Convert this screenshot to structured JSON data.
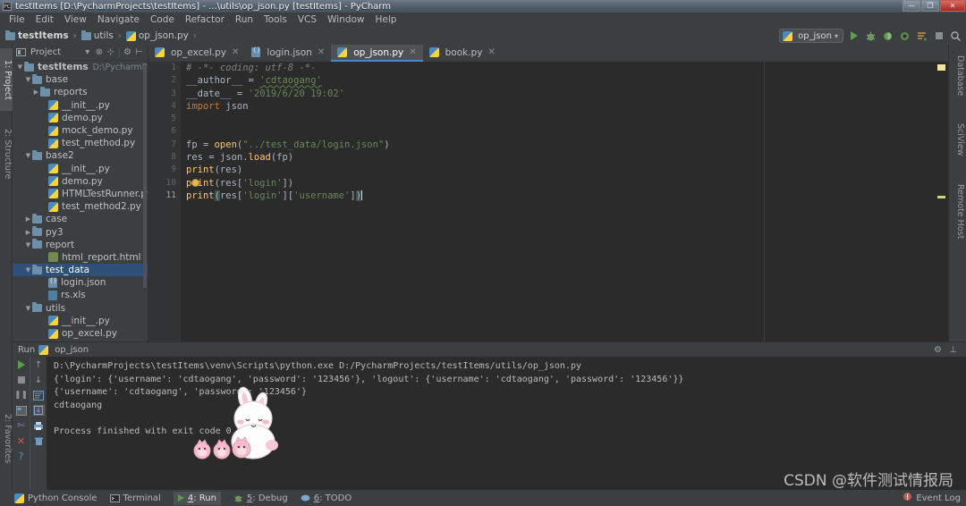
{
  "window": {
    "title": "testItems [D:\\PycharmProjects\\testItems] - ...\\utils\\op_json.py [testItems] - PyCharm",
    "app_icon": "pycharm-icon",
    "minimize_label": "—",
    "maximize_label": "❐",
    "close_label": "✕"
  },
  "menu": {
    "items": [
      "File",
      "Edit",
      "View",
      "Navigate",
      "Code",
      "Refactor",
      "Run",
      "Tools",
      "VCS",
      "Window",
      "Help"
    ]
  },
  "breadcrumb": {
    "items": [
      {
        "label": "testItems",
        "icon": "folder-icon",
        "bold": true
      },
      {
        "label": "utils",
        "icon": "folder-icon",
        "bold": false
      },
      {
        "label": "op_json.py",
        "icon": "python-file-icon",
        "bold": false
      }
    ],
    "separator": "›"
  },
  "toolbar": {
    "run_config": "op_json",
    "run_config_icon": "python-file-icon",
    "dropdown_caret": "▾",
    "buttons": [
      {
        "name": "run-button",
        "glyph": "▶"
      },
      {
        "name": "debug-button",
        "glyph": "🐞"
      },
      {
        "name": "coverage-button",
        "glyph": "◑"
      },
      {
        "name": "profile-button",
        "glyph": "◍"
      },
      {
        "name": "attach-button",
        "glyph": "≡"
      },
      {
        "name": "stop-button",
        "glyph": "■"
      },
      {
        "name": "search-button",
        "glyph": "⌕"
      }
    ]
  },
  "left_strip": {
    "tabs": [
      {
        "label": "1: Project",
        "active": true
      },
      {
        "label": "2: Structure",
        "active": false
      }
    ],
    "bottom_tabs": [
      {
        "label": "2: Favorites",
        "active": false
      }
    ]
  },
  "right_strip": {
    "tabs": [
      "Database",
      "SciView",
      "Remote Host"
    ]
  },
  "project_panel": {
    "title": "Project",
    "header_icons": [
      "project-view-icon",
      "dropdown-caret-icon",
      "collapse-all-icon",
      "scroll-from-source-icon",
      "settings-icon",
      "hide-icon"
    ],
    "tree": [
      {
        "depth": 0,
        "arrow": "▼",
        "icon": "folder-icon",
        "label": "testItems",
        "path": "D:\\PycharmProjects\\",
        "bold": true,
        "selected": false
      },
      {
        "depth": 1,
        "arrow": "▼",
        "icon": "folder-icon",
        "label": "base",
        "path": "",
        "bold": false,
        "selected": false
      },
      {
        "depth": 2,
        "arrow": "▶",
        "icon": "folder-icon",
        "label": "reports",
        "path": "",
        "bold": false,
        "selected": false
      },
      {
        "depth": 3,
        "arrow": "",
        "icon": "python-file-icon",
        "label": "__init__.py",
        "path": "",
        "bold": false,
        "selected": false
      },
      {
        "depth": 3,
        "arrow": "",
        "icon": "python-file-icon",
        "label": "demo.py",
        "path": "",
        "bold": false,
        "selected": false
      },
      {
        "depth": 3,
        "arrow": "",
        "icon": "python-file-icon",
        "label": "mock_demo.py",
        "path": "",
        "bold": false,
        "selected": false
      },
      {
        "depth": 3,
        "arrow": "",
        "icon": "python-file-icon",
        "label": "test_method.py",
        "path": "",
        "bold": false,
        "selected": false
      },
      {
        "depth": 1,
        "arrow": "▼",
        "icon": "folder-icon",
        "label": "base2",
        "path": "",
        "bold": false,
        "selected": false
      },
      {
        "depth": 3,
        "arrow": "",
        "icon": "python-file-icon",
        "label": "__init__.py",
        "path": "",
        "bold": false,
        "selected": false
      },
      {
        "depth": 3,
        "arrow": "",
        "icon": "python-file-icon",
        "label": "demo.py",
        "path": "",
        "bold": false,
        "selected": false
      },
      {
        "depth": 3,
        "arrow": "",
        "icon": "python-file-icon",
        "label": "HTMLTestRunner.py",
        "path": "",
        "bold": false,
        "selected": false
      },
      {
        "depth": 3,
        "arrow": "",
        "icon": "python-file-icon",
        "label": "test_method2.py",
        "path": "",
        "bold": false,
        "selected": false
      },
      {
        "depth": 1,
        "arrow": "▶",
        "icon": "folder-icon",
        "label": "case",
        "path": "",
        "bold": false,
        "selected": false
      },
      {
        "depth": 1,
        "arrow": "▶",
        "icon": "folder-icon",
        "label": "py3",
        "path": "",
        "bold": false,
        "selected": false
      },
      {
        "depth": 1,
        "arrow": "▼",
        "icon": "folder-icon",
        "label": "report",
        "path": "",
        "bold": false,
        "selected": false
      },
      {
        "depth": 3,
        "arrow": "",
        "icon": "html-file-icon",
        "label": "html_report.html",
        "path": "",
        "bold": false,
        "selected": false
      },
      {
        "depth": 1,
        "arrow": "▼",
        "icon": "folder-icon",
        "label": "test_data",
        "path": "",
        "bold": false,
        "selected": true
      },
      {
        "depth": 3,
        "arrow": "",
        "icon": "json-file-icon",
        "label": "login.json",
        "path": "",
        "bold": false,
        "selected": false
      },
      {
        "depth": 3,
        "arrow": "",
        "icon": "xls-file-icon",
        "label": "rs.xls",
        "path": "",
        "bold": false,
        "selected": false
      },
      {
        "depth": 1,
        "arrow": "▼",
        "icon": "folder-icon",
        "label": "utils",
        "path": "",
        "bold": false,
        "selected": false
      },
      {
        "depth": 3,
        "arrow": "",
        "icon": "python-file-icon",
        "label": "__init__.py",
        "path": "",
        "bold": false,
        "selected": false
      },
      {
        "depth": 3,
        "arrow": "",
        "icon": "python-file-icon",
        "label": "op_excel.py",
        "path": "",
        "bold": false,
        "selected": false
      }
    ]
  },
  "editor": {
    "tabs": [
      {
        "label": "op_excel.py",
        "icon": "python-file-icon",
        "active": false,
        "close": "✕"
      },
      {
        "label": "login.json",
        "icon": "json-file-icon",
        "active": false,
        "close": "✕"
      },
      {
        "label": "op_json.py",
        "icon": "python-file-icon",
        "active": true,
        "close": "✕"
      },
      {
        "label": "book.py",
        "icon": "python-file-icon",
        "active": false,
        "close": "✕"
      }
    ],
    "line_numbers": [
      "1",
      "2",
      "3",
      "4",
      "5",
      "6",
      "7",
      "8",
      "9",
      "10",
      "11"
    ],
    "current_line": 11,
    "code_lines": [
      "# -*- coding: utf-8 -*-",
      "__author__ = 'cdtaogang'",
      "__date__ = '2019/6/20 19:02'",
      "import json",
      "",
      "",
      "fp = open(\"../test_data/login.json\")",
      "res = json.load(fp)",
      "print(res)",
      "print(res['login'])",
      "print(res['login']['username'])"
    ]
  },
  "run_window": {
    "title": "Run",
    "config_name": "op_json",
    "config_icon": "python-file-icon",
    "left_tool_icons": [
      "rerun-icon",
      "stop-icon",
      "pause-icon",
      "console-icon",
      "pin-icon",
      "close-icon",
      "help-icon"
    ],
    "right_tool_icons": [
      "scroll-up-icon",
      "scroll-down-icon",
      "soft-wrap-icon",
      "scroll-to-end-icon",
      "print-icon",
      "clear-all-icon"
    ],
    "settings_icon": "gear-icon",
    "hide_icon": "hide-icon",
    "console_lines": [
      "D:\\PycharmProjects\\testItems\\venv\\Scripts\\python.exe D:/PycharmProjects/testItems/utils/op_json.py",
      "{'login': {'username': 'cdtaogang', 'password': '123456'}, 'logout': {'username': 'cdtaogang', 'password': '123456'}}",
      "{'username': 'cdtaogang', 'password': '123456'}",
      "cdtaogang",
      "",
      "Process finished with exit code 0"
    ]
  },
  "status_bar": {
    "items": [
      {
        "label": "Python Console",
        "icon": "python-icon",
        "active": false,
        "mnemonic": ""
      },
      {
        "label": "Terminal",
        "icon": "terminal-icon",
        "active": false,
        "mnemonic": ""
      },
      {
        "label": "4: Run",
        "icon": "run-icon",
        "active": true,
        "mnemonic": "4"
      },
      {
        "label": "5: Debug",
        "icon": "debug-icon",
        "active": false,
        "mnemonic": "5"
      },
      {
        "label": "6: TODO",
        "icon": "todo-icon",
        "active": false,
        "mnemonic": "6"
      }
    ],
    "event_log": "Event Log",
    "event_log_icon": "event-log-icon"
  },
  "watermark": {
    "text": "CSDN @软件测试情报局",
    "url": "https://blog.csdn.net/weixin_44237185"
  },
  "colors": {
    "accent": "#4a88c7",
    "selection": "#2f5179",
    "editor_bg": "#2b2b2b",
    "panel_bg": "#3c3f41",
    "string": "#6a8759",
    "keyword": "#cc7832",
    "comment": "#808080",
    "function": "#ffc66d",
    "run_green": "#5c9e48"
  }
}
